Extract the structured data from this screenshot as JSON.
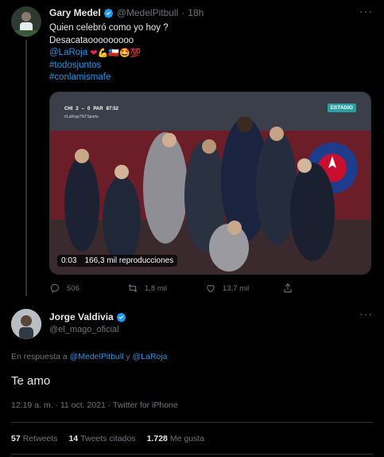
{
  "tweet": {
    "author_name": "Gary Medel",
    "author_handle": "@MedelPitbull",
    "separator": "·",
    "time": "18h",
    "more_menu": "···",
    "lines": {
      "line1": "Quien celebró como yo hoy ?",
      "line2": "Desacataooooooooo",
      "mention": "@LaRoja",
      "emojis": [
        "❤",
        "💪",
        "🇨🇱",
        "🤩",
        "💯"
      ],
      "hashtag1": "#todosjuntos",
      "hashtag2": "#conlamismafe"
    },
    "video": {
      "timestamp": "0:03",
      "views": "166,3 mil reproducciones",
      "scorebug_home": "CHI",
      "scorebug_home_score": "2",
      "scorebug_away_score": "0",
      "scorebug_away": "PAR",
      "scorebug_clock": "87:52",
      "scorebug_tag": "#LaRojaTNTSports",
      "channel_badge": "ESTADIO"
    },
    "actions": {
      "replies": "506",
      "retweets": "1,8 mil",
      "likes": "13,7 mil",
      "share": ""
    }
  },
  "reply": {
    "author_name": "Jorge Valdivia",
    "author_handle": "@el_mago_oficial",
    "more_menu": "···",
    "reply_prefix": "En respuesta a",
    "reply_user1": "@MedelPitbull",
    "reply_conj": "y",
    "reply_user2": "@LaRoja",
    "text": "Te amo",
    "meta": "12:19 a. m. · 11 oct. 2021 · Twitter for iPhone",
    "stats": {
      "retweets_count": "57",
      "retweets_label": "Retweets",
      "quotes_count": "14",
      "quotes_label": "Tweets citados",
      "likes_count": "1.728",
      "likes_label": "Me gusta"
    }
  },
  "colors": {
    "background": "#000000",
    "link": "#1d9bf0",
    "muted": "#71767b",
    "text": "#e7e9ea",
    "divider": "#2f3336",
    "verified": "#1d9bf0"
  },
  "icons": [
    "verified-badge-icon",
    "reply-icon",
    "retweet-icon",
    "like-icon",
    "share-icon",
    "more-icon"
  ]
}
